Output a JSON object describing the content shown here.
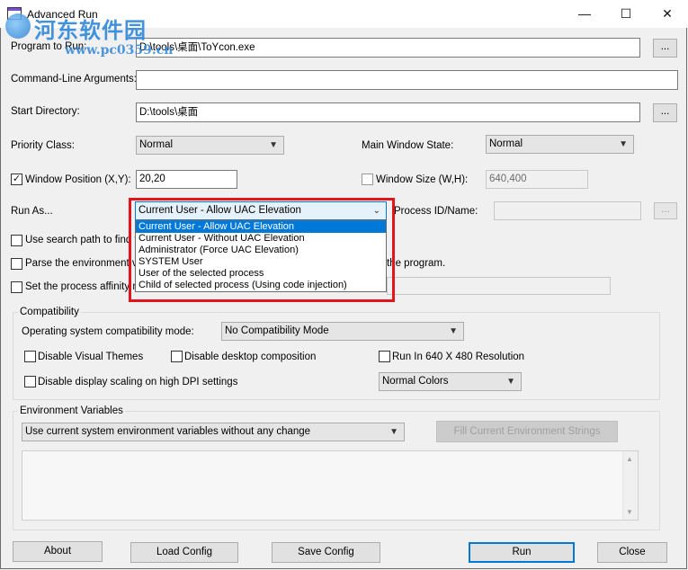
{
  "window": {
    "title": "Advanced Run",
    "minimize_glyph": "—",
    "maximize_glyph": "☐",
    "close_glyph": "✕"
  },
  "watermark": {
    "cn_text": "河东软件园",
    "url": "www.pc0359.cn"
  },
  "form": {
    "program_label": "Program to Run:",
    "program_value": "D:\\tools\\桌面\\ToYcon.exe",
    "browse_label": "...",
    "cmdline_label": "Command-Line Arguments:",
    "cmdline_value": "",
    "startdir_label": "Start Directory:",
    "startdir_value": "D:\\tools\\桌面",
    "priority_label": "Priority Class:",
    "priority_value": "Normal",
    "mainwin_label": "Main Window State:",
    "mainwin_value": "Normal",
    "winpos_label": "Window Position (X,Y):",
    "winpos_checked": "✓",
    "winpos_value": "20,20",
    "winsize_label": "Window Size (W,H):",
    "winsize_value": "640,400",
    "runas_label": "Run As...",
    "runas_value": "Current User - Allow UAC Elevation",
    "processid_label": "Process ID/Name:",
    "processid_value": "",
    "searchpath_label": "Use search path to find th",
    "parseenv_label": "Parse the environment va",
    "parseenv_tail": "the program.",
    "affinity_label": "Set the process affinity m"
  },
  "runas_options": [
    "Current User - Allow UAC Elevation",
    "Current User - Without UAC Elevation",
    "Administrator (Force UAC Elevation)",
    "SYSTEM User",
    "User of the selected process",
    "Child of selected process (Using code injection)"
  ],
  "compat": {
    "group_title": "Compatibility",
    "os_label": "Operating system compatibility mode:",
    "os_value": "No Compatibility Mode",
    "visual_themes": "Disable Visual Themes",
    "desktop_comp": "Disable desktop composition",
    "run640": "Run In 640 X 480 Resolution",
    "dpi_scaling": "Disable display scaling on high DPI settings",
    "colors_value": "Normal Colors"
  },
  "env": {
    "group_title": "Environment Variables",
    "mode_value": "Use current system environment variables without any change",
    "fill_button": "Fill Current Environment Strings"
  },
  "buttons": {
    "about": "About",
    "load_config": "Load Config",
    "save_config": "Save Config",
    "run": "Run",
    "close": "Close"
  },
  "colors": {
    "highlight_border": "#e1151b",
    "selection": "#0078d7"
  }
}
